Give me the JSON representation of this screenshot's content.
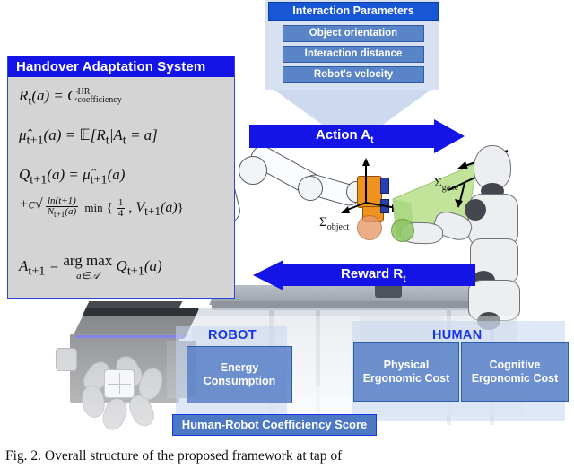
{
  "figure": {
    "caption": "Fig. 2.  Overall structure of the proposed framework at tap of"
  },
  "interaction_parameters": {
    "title": "Interaction Parameters",
    "items": [
      {
        "label": "Object orientation"
      },
      {
        "label": "Interaction distance"
      },
      {
        "label": "Robot's velocity"
      }
    ]
  },
  "flow": {
    "action_label": "Action A",
    "action_sub": "t",
    "reward_label": "Reward R",
    "reward_sub": "t"
  },
  "handover": {
    "title": "Handover Adaptation System",
    "equations": [
      "R_t(a) = C^HR_coefficiency",
      "mu_hat_{t+1}(a) = E[R_t | A_t = a]",
      "Q_{t+1}(a) = mu_hat_{t+1}(a) + c sqrt( ln(t+1)/N_{t+1}(a) min{ 1/4 , V_{t+1}(a) } )",
      "A_{t+1} = arg max_{a in A} Q_{t+1}(a)"
    ]
  },
  "scene_labels": {
    "sigma_object": "Σ",
    "sigma_object_sub": "object",
    "sigma_gaze": "Σ",
    "sigma_gaze_sub": "gaze"
  },
  "metrics": {
    "robot_group": "ROBOT",
    "human_group": "HUMAN",
    "robot_costs": [
      {
        "line1": "Energy",
        "line2": "Consumption"
      }
    ],
    "human_costs": [
      {
        "line1": "Physical",
        "line2": "Ergonomic Cost"
      },
      {
        "line1": "Cognitive",
        "line2": "Ergonomic Cost"
      }
    ],
    "score_label": "Human-Robot Coefficiency Score"
  },
  "colors": {
    "accent_blue": "#1414e6",
    "header_blue": "#1757d6",
    "item_blue": "#5a84c8",
    "panel_blue": "#4d79c4",
    "gaze_green": "#c2e39a",
    "object_orange": "#f0921f",
    "box_gray": "#d4d4d4"
  }
}
